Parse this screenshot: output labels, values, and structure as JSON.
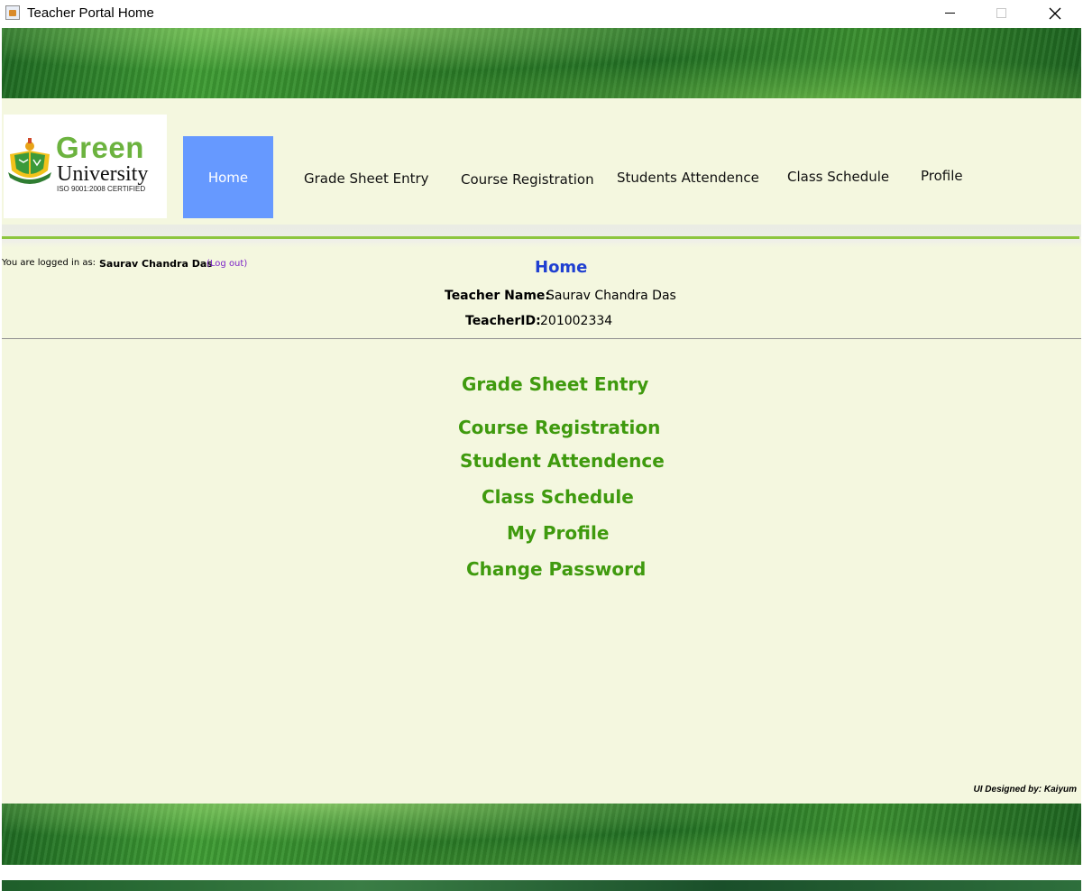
{
  "window": {
    "title": "Teacher Portal Home"
  },
  "logo": {
    "name_line1": "Green",
    "name_line2": "University",
    "certification": "ISO 9001:2008 CERTIFIED",
    "crest_icon": "university-crest-icon",
    "brand_color": "#6cb33f"
  },
  "nav": {
    "active_color": "#6699ff",
    "items": [
      {
        "label": "Home",
        "active": true
      },
      {
        "label": "Grade Sheet Entry"
      },
      {
        "label": "Course Registration"
      },
      {
        "label": "Students Attendence"
      },
      {
        "label": "Class Schedule"
      },
      {
        "label": "Profile"
      }
    ]
  },
  "session": {
    "prefix": "You are logged in as:",
    "user": "Saurav Chandra Das",
    "logout": "(Log out)"
  },
  "page": {
    "heading": "Home",
    "teacher_name_label": "Teacher Name:",
    "teacher_name": "Saurav Chandra Das",
    "teacher_id_label": "TeacherID:",
    "teacher_id": "201002334"
  },
  "menu": {
    "link_color": "#3f9a0e",
    "items": [
      "Grade Sheet Entry",
      "Course Registration",
      "Student Attendence",
      "Class Schedule",
      "My Profile",
      "Change Password"
    ]
  },
  "footer": {
    "credit": "UI Designed by: Kaiyum"
  }
}
